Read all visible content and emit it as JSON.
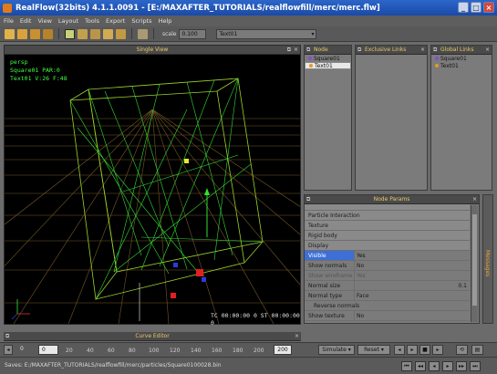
{
  "window": {
    "title": "RealFlow(32bits) 4.1.1.0091 - [E:/MAXAFTER_TUTORIALS/realflowfill/merc/merc.flw]"
  },
  "menu": [
    "File",
    "Edit",
    "View",
    "Layout",
    "Tools",
    "Export",
    "Scripts",
    "Help"
  ],
  "toolbar": {
    "scale_label": "scale",
    "scale_value": "0.100",
    "node_select": "Text01"
  },
  "viewport": {
    "title": "Single View",
    "hud_lines": [
      "persp",
      "Square01 PAR:0",
      "Text01 V:26 F:48"
    ],
    "timecode": "TC 00:00:00 0    ST 00:00:00 0"
  },
  "panels": {
    "nodes": {
      "title": "Node",
      "items": [
        "Square01",
        "Text01"
      ]
    },
    "exclusive": {
      "title": "Exclusive Links"
    },
    "global": {
      "title": "Global Links",
      "items": [
        "Square01",
        "Text01"
      ]
    }
  },
  "params": {
    "title": "Node Params",
    "groups": [
      "Particle Interaction",
      "Texture",
      "Rigid body",
      "Display"
    ],
    "rows": [
      {
        "k": "Visible",
        "v": "Yes"
      },
      {
        "k": "Show normals",
        "v": "No"
      },
      {
        "k": "Show wireframe",
        "v": "Yes"
      },
      {
        "k": "Normal size",
        "v": "0.1"
      },
      {
        "k": "Normal type",
        "v": "Face"
      },
      {
        "k": "Reverse normals",
        "v": ""
      },
      {
        "k": "Show texture",
        "v": "No"
      }
    ]
  },
  "messages_tab": "Messages",
  "curve_editor": {
    "title": "Curve Editor"
  },
  "timeline": {
    "start": "0",
    "current": "0",
    "end": "200",
    "ticks": [
      "20",
      "40",
      "60",
      "80",
      "100",
      "120",
      "140",
      "160",
      "180",
      "200"
    ],
    "simulate_label": "Simulate",
    "reset_label": "Reset"
  },
  "status": {
    "text": "Saves: E:/MAXAFTER_TUTORIALS/realflowfill/merc/particles/Square0100028.bin"
  }
}
